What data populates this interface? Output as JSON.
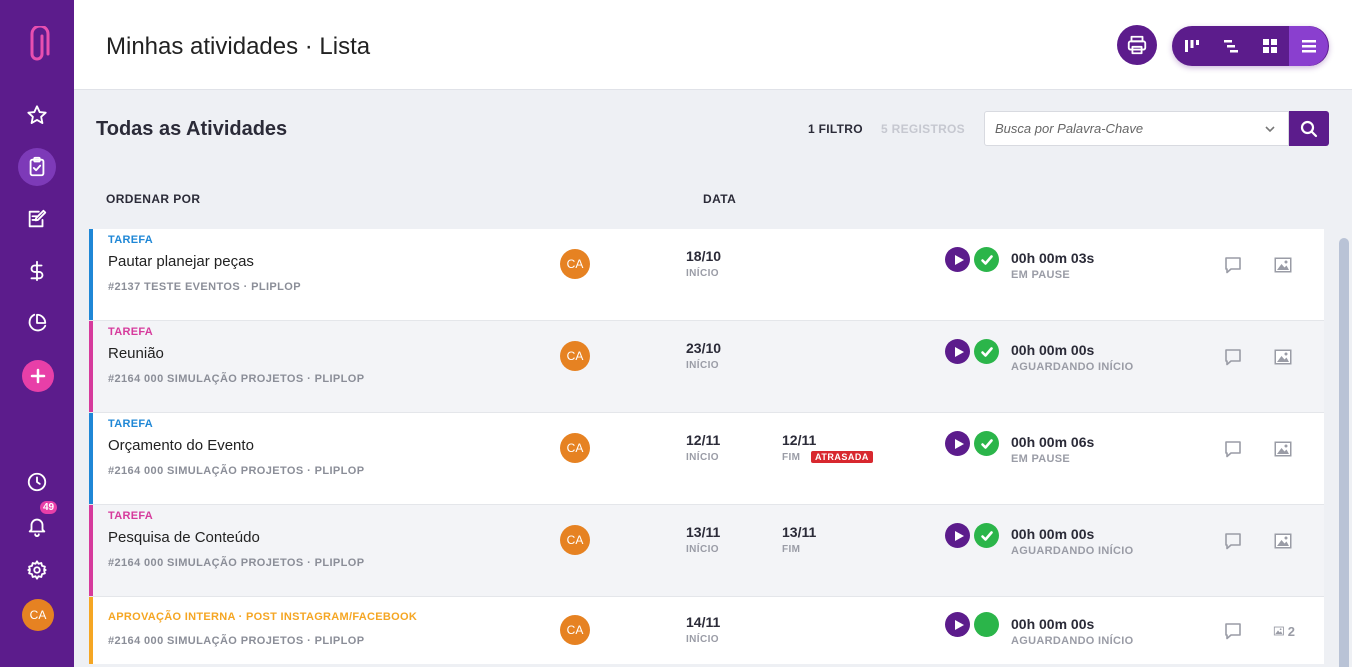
{
  "header": {
    "title": "Minhas atividades · Lista"
  },
  "toolbar": {
    "section_title": "Todas as Atividades",
    "filter_count": "1 FILTRO",
    "record_count": "5 REGISTROS",
    "search_placeholder": "Busca por Palavra-Chave"
  },
  "columns": {
    "sort_by": "ORDENAR POR",
    "date": "DATA"
  },
  "sidebar": {
    "notification_count": "49",
    "user_initials": "CA"
  },
  "colors": {
    "brand": "#5c1c8c",
    "accent_pink": "#e83fa8",
    "type_blue": "#1f87d6",
    "type_pink": "#d63a9c",
    "type_orange": "#f5a623",
    "success": "#2bb54a",
    "danger": "#d8282f"
  },
  "activities": [
    {
      "type": "TAREFA",
      "title": "Pautar planejar peças",
      "meta": "#2137 TESTE EVENTOS  ·  PLIPLOP",
      "assignee": "CA",
      "start_date": "18/10",
      "start_label": "INÍCIO",
      "end_date": "",
      "end_label": "",
      "late_label": "",
      "timer": "00h 00m 03s",
      "status": "EM PAUSE",
      "image_count": ""
    },
    {
      "type": "TAREFA",
      "title": "Reunião",
      "meta": "#2164 000 SIMULAÇÃO PROJETOS  ·  PLIPLOP",
      "assignee": "CA",
      "start_date": "23/10",
      "start_label": "INÍCIO",
      "end_date": "",
      "end_label": "",
      "late_label": "",
      "timer": "00h 00m 00s",
      "status": "AGUARDANDO INÍCIO",
      "image_count": ""
    },
    {
      "type": "TAREFA",
      "title": "Orçamento do Evento",
      "meta": "#2164 000 SIMULAÇÃO PROJETOS  ·  PLIPLOP",
      "assignee": "CA",
      "start_date": "12/11",
      "start_label": "INÍCIO",
      "end_date": "12/11",
      "end_label": "FIM",
      "late_label": "ATRASADA",
      "timer": "00h 00m 06s",
      "status": "EM PAUSE",
      "image_count": ""
    },
    {
      "type": "TAREFA",
      "title": "Pesquisa de Conteúdo",
      "meta": "#2164 000 SIMULAÇÃO PROJETOS  ·  PLIPLOP",
      "assignee": "CA",
      "start_date": "13/11",
      "start_label": "INÍCIO",
      "end_date": "13/11",
      "end_label": "FIM",
      "late_label": "",
      "timer": "00h 00m 00s",
      "status": "AGUARDANDO INÍCIO",
      "image_count": ""
    },
    {
      "type": "APROVAÇÃO INTERNA  ·  POST INSTAGRAM/FACEBOOK",
      "title": "",
      "meta": "#2164 000 SIMULAÇÃO PROJETOS  ·  PLIPLOP",
      "assignee": "CA",
      "start_date": "14/11",
      "start_label": "INÍCIO",
      "end_date": "",
      "end_label": "",
      "late_label": "",
      "timer": "00h 00m 00s",
      "status": "AGUARDANDO INÍCIO",
      "image_count": "2"
    }
  ]
}
